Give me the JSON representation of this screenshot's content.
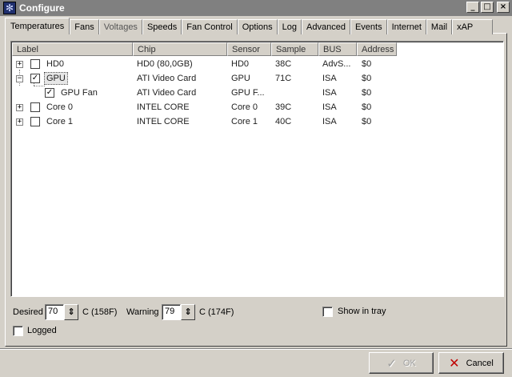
{
  "window": {
    "title": "Configure",
    "icon": "fan-icon"
  },
  "title_buttons": {
    "minimize": "_",
    "maximize": "□",
    "close": "×"
  },
  "tabs": [
    {
      "label": "Temperatures",
      "active": true
    },
    {
      "label": "Fans"
    },
    {
      "label": "Voltages"
    },
    {
      "label": "Speeds"
    },
    {
      "label": "Fan Control"
    },
    {
      "label": "Options"
    },
    {
      "label": "Log"
    },
    {
      "label": "Advanced"
    },
    {
      "label": "Events"
    },
    {
      "label": "Internet"
    },
    {
      "label": "Mail"
    },
    {
      "label": "xAP"
    }
  ],
  "table": {
    "columns": [
      "Label",
      "Chip",
      "Sensor",
      "Sample",
      "BUS",
      "Address"
    ],
    "rows": [
      {
        "label": "HD0",
        "chip": "HD0 (80,0GB)",
        "sensor": "HD0",
        "sample": "38C",
        "bus": "AdvS...",
        "address": "$0",
        "expander": "+",
        "checked": false
      },
      {
        "label": "GPU",
        "chip": "ATI Video Card",
        "sensor": "GPU",
        "sample": "71C",
        "bus": "ISA",
        "address": "$0",
        "expander": "−",
        "checked": true
      },
      {
        "label": "GPU Fan",
        "chip": "ATI Video Card",
        "sensor": "GPU F...",
        "sample": "",
        "bus": "ISA",
        "address": "$0",
        "checked": true
      },
      {
        "label": "Core 0",
        "chip": "INTEL CORE",
        "sensor": "Core 0",
        "sample": "39C",
        "bus": "ISA",
        "address": "$0",
        "expander": "+",
        "checked": false
      },
      {
        "label": "Core 1",
        "chip": "INTEL CORE",
        "sensor": "Core 1",
        "sample": "40C",
        "bus": "ISA",
        "address": "$0",
        "expander": "+",
        "checked": false
      }
    ]
  },
  "settings": {
    "desired_label": "Desired",
    "desired_value": "70",
    "desired_unit": "C (158F)",
    "warning_label": "Warning",
    "warning_value": "79",
    "warning_unit": "C (174F)",
    "show_in_tray_label": "Show in tray",
    "logged_label": "Logged"
  },
  "buttons": {
    "ok_label": "OK",
    "cancel_label": "Cancel",
    "check_glyph": "✓",
    "cancel_glyph": "✕"
  },
  "colors": {
    "title_bar": "#808080",
    "face": "#d4d0c8",
    "cancel_icon": "#c00000"
  }
}
